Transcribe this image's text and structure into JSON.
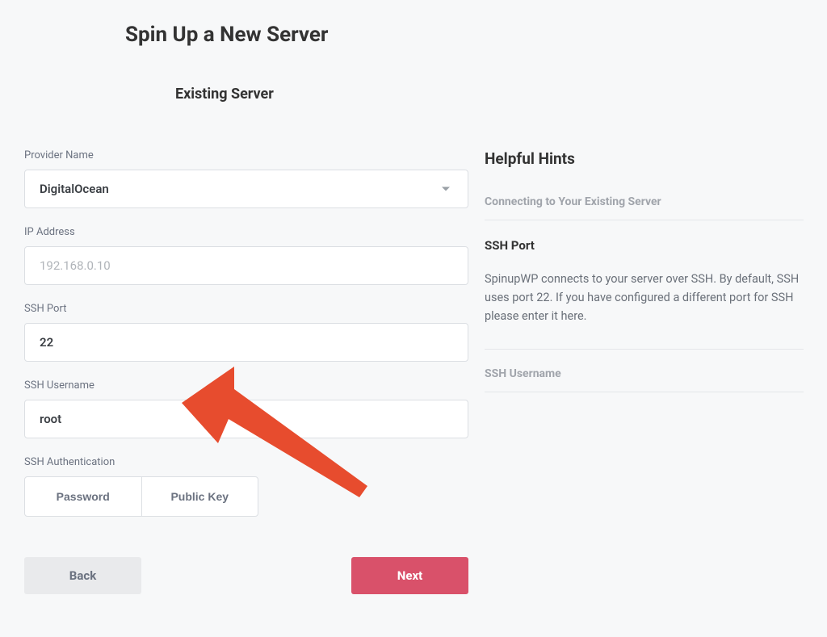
{
  "page": {
    "title": "Spin Up a New Server",
    "section": "Existing Server"
  },
  "form": {
    "provider": {
      "label": "Provider Name",
      "value": "DigitalOcean"
    },
    "ip": {
      "label": "IP Address",
      "placeholder": "192.168.0.10",
      "value": ""
    },
    "ssh_port": {
      "label": "SSH Port",
      "value": "22"
    },
    "ssh_user": {
      "label": "SSH Username",
      "value": "root"
    },
    "ssh_auth": {
      "label": "SSH Authentication",
      "options": [
        "Password",
        "Public Key"
      ]
    }
  },
  "actions": {
    "back": "Back",
    "next": "Next"
  },
  "hints": {
    "title": "Helpful Hints",
    "connecting_label": "Connecting to Your Existing Server",
    "active": {
      "title": "SSH Port",
      "body": "SpinupWP connects to your server over SSH. By default, SSH uses port 22. If you have configured a different port for SSH please enter it here."
    },
    "ssh_username_label": "SSH Username"
  }
}
